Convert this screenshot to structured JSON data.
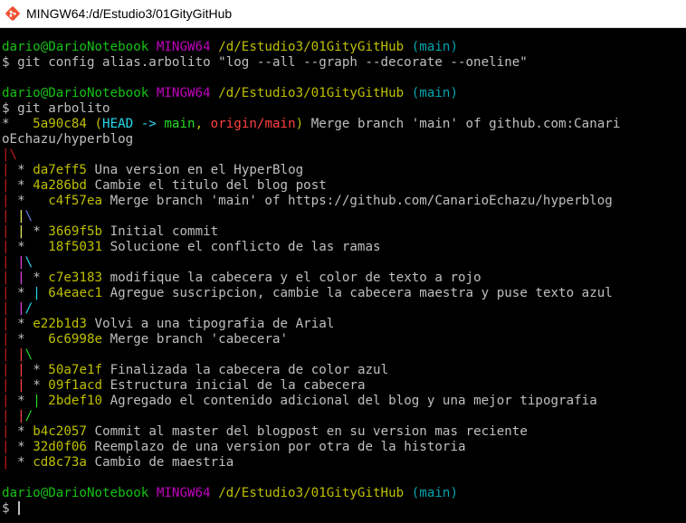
{
  "window": {
    "title": "MINGW64:/d/Estudio3/01GityGitHub",
    "icon": "git-bash-icon"
  },
  "colors": {
    "background": "#000000",
    "default": "#bfbfbf",
    "green": "#15c215",
    "magenta": "#c000c0",
    "yellow": "#bfbf00",
    "cyan": "#00a6b2",
    "red": "#c41b17",
    "brightRed": "#ff4040",
    "brightCyan": "#25d8ec",
    "brightGreen": "#25d825",
    "brightYellow": "#e8e85a",
    "brightMagenta": "#e040e0",
    "blue": "#5c7ee0"
  },
  "terminal": {
    "lines": [
      [
        {
          "t": "dario@DarioNotebook",
          "c": "green"
        },
        {
          "t": " ",
          "c": "default"
        },
        {
          "t": "MINGW64",
          "c": "magenta"
        },
        {
          "t": " ",
          "c": "default"
        },
        {
          "t": "/d/Estudio3/01GityGitHub",
          "c": "yellow"
        },
        {
          "t": " ",
          "c": "default"
        },
        {
          "t": "(main)",
          "c": "cyan"
        }
      ],
      [
        {
          "t": "$ git config alias.arbolito \"log --all --graph --decorate --oneline\"",
          "c": "default"
        }
      ],
      [],
      [
        {
          "t": "dario@DarioNotebook",
          "c": "green"
        },
        {
          "t": " ",
          "c": "default"
        },
        {
          "t": "MINGW64",
          "c": "magenta"
        },
        {
          "t": " ",
          "c": "default"
        },
        {
          "t": "/d/Estudio3/01GityGitHub",
          "c": "yellow"
        },
        {
          "t": " ",
          "c": "default"
        },
        {
          "t": "(main)",
          "c": "cyan"
        }
      ],
      [
        {
          "t": "$ git arbolito",
          "c": "default"
        }
      ],
      [
        {
          "t": "*   ",
          "c": "default"
        },
        {
          "t": "5a90c84 (",
          "c": "yellow"
        },
        {
          "t": "HEAD -> ",
          "c": "brightCyan"
        },
        {
          "t": "main",
          "c": "brightGreen"
        },
        {
          "t": ", ",
          "c": "yellow"
        },
        {
          "t": "origin/main",
          "c": "brightRed"
        },
        {
          "t": ")",
          "c": "yellow"
        },
        {
          "t": " Merge branch 'main' of github.com:Canari",
          "c": "default"
        }
      ],
      [
        {
          "t": "oEchazu/hyperblog",
          "c": "default"
        }
      ],
      [
        {
          "t": "|\\",
          "c": "red"
        }
      ],
      [
        {
          "t": "| ",
          "c": "red"
        },
        {
          "t": "* ",
          "c": "default"
        },
        {
          "t": "da7eff5",
          "c": "yellow"
        },
        {
          "t": " Una version en el HyperBlog",
          "c": "default"
        }
      ],
      [
        {
          "t": "| ",
          "c": "red"
        },
        {
          "t": "* ",
          "c": "default"
        },
        {
          "t": "4a286bd",
          "c": "yellow"
        },
        {
          "t": " Cambie el titulo del blog post",
          "c": "default"
        }
      ],
      [
        {
          "t": "| ",
          "c": "red"
        },
        {
          "t": "*   ",
          "c": "default"
        },
        {
          "t": "c4f57ea",
          "c": "yellow"
        },
        {
          "t": " Merge branch 'main' of https://github.com/CanarioEchazu/hyperblog",
          "c": "default"
        }
      ],
      [
        {
          "t": "| ",
          "c": "red"
        },
        {
          "t": "|",
          "c": "brightYellow"
        },
        {
          "t": "\\",
          "c": "blue"
        }
      ],
      [
        {
          "t": "| ",
          "c": "red"
        },
        {
          "t": "| ",
          "c": "brightYellow"
        },
        {
          "t": "* ",
          "c": "default"
        },
        {
          "t": "3669f5b",
          "c": "yellow"
        },
        {
          "t": " Initial commit",
          "c": "default"
        }
      ],
      [
        {
          "t": "| ",
          "c": "red"
        },
        {
          "t": "*   ",
          "c": "default"
        },
        {
          "t": "18f5031",
          "c": "yellow"
        },
        {
          "t": " Solucione el conflicto de las ramas",
          "c": "default"
        }
      ],
      [
        {
          "t": "| ",
          "c": "red"
        },
        {
          "t": "|",
          "c": "brightMagenta"
        },
        {
          "t": "\\",
          "c": "brightCyan"
        }
      ],
      [
        {
          "t": "| ",
          "c": "red"
        },
        {
          "t": "| ",
          "c": "brightMagenta"
        },
        {
          "t": "* ",
          "c": "default"
        },
        {
          "t": "c7e3183",
          "c": "yellow"
        },
        {
          "t": " modifique la cabecera y el color de texto a rojo",
          "c": "default"
        }
      ],
      [
        {
          "t": "| ",
          "c": "red"
        },
        {
          "t": "* ",
          "c": "default"
        },
        {
          "t": "| ",
          "c": "brightCyan"
        },
        {
          "t": "64eaec1",
          "c": "yellow"
        },
        {
          "t": " Agregue suscripcion, cambie la cabecera maestra y puse texto azul",
          "c": "default"
        }
      ],
      [
        {
          "t": "| ",
          "c": "red"
        },
        {
          "t": "|",
          "c": "brightMagenta"
        },
        {
          "t": "/",
          "c": "brightCyan"
        }
      ],
      [
        {
          "t": "| ",
          "c": "red"
        },
        {
          "t": "* ",
          "c": "default"
        },
        {
          "t": "e22b1d3",
          "c": "yellow"
        },
        {
          "t": " Volvi a una tipografia de Arial",
          "c": "default"
        }
      ],
      [
        {
          "t": "| ",
          "c": "red"
        },
        {
          "t": "*   ",
          "c": "default"
        },
        {
          "t": "6c6998e",
          "c": "yellow"
        },
        {
          "t": " Merge branch 'cabecera'",
          "c": "default"
        }
      ],
      [
        {
          "t": "| ",
          "c": "red"
        },
        {
          "t": "|",
          "c": "brightRed"
        },
        {
          "t": "\\",
          "c": "brightGreen"
        }
      ],
      [
        {
          "t": "| ",
          "c": "red"
        },
        {
          "t": "| ",
          "c": "brightRed"
        },
        {
          "t": "* ",
          "c": "default"
        },
        {
          "t": "50a7e1f",
          "c": "yellow"
        },
        {
          "t": " Finalizada la cabecera de color azul",
          "c": "default"
        }
      ],
      [
        {
          "t": "| ",
          "c": "red"
        },
        {
          "t": "| ",
          "c": "brightRed"
        },
        {
          "t": "* ",
          "c": "default"
        },
        {
          "t": "09f1acd",
          "c": "yellow"
        },
        {
          "t": " Estructura inicial de la cabecera",
          "c": "default"
        }
      ],
      [
        {
          "t": "| ",
          "c": "red"
        },
        {
          "t": "* ",
          "c": "default"
        },
        {
          "t": "| ",
          "c": "brightGreen"
        },
        {
          "t": "2bdef10",
          "c": "yellow"
        },
        {
          "t": " Agregado el contenido adicional del blog y una mejor tipografia",
          "c": "default"
        }
      ],
      [
        {
          "t": "| ",
          "c": "red"
        },
        {
          "t": "|",
          "c": "brightRed"
        },
        {
          "t": "/",
          "c": "brightGreen"
        }
      ],
      [
        {
          "t": "| ",
          "c": "red"
        },
        {
          "t": "* ",
          "c": "default"
        },
        {
          "t": "b4c2057",
          "c": "yellow"
        },
        {
          "t": " Commit al master del blogpost en su version mas reciente",
          "c": "default"
        }
      ],
      [
        {
          "t": "| ",
          "c": "red"
        },
        {
          "t": "* ",
          "c": "default"
        },
        {
          "t": "32d0f06",
          "c": "yellow"
        },
        {
          "t": " Reemplazo de una version por otra de la historia",
          "c": "default"
        }
      ],
      [
        {
          "t": "| ",
          "c": "red"
        },
        {
          "t": "* ",
          "c": "default"
        },
        {
          "t": "cd8c73a",
          "c": "yellow"
        },
        {
          "t": " Cambio de maestria",
          "c": "default"
        }
      ],
      [],
      [
        {
          "t": "dario@DarioNotebook",
          "c": "green"
        },
        {
          "t": " ",
          "c": "default"
        },
        {
          "t": "MINGW64",
          "c": "magenta"
        },
        {
          "t": " ",
          "c": "default"
        },
        {
          "t": "/d/Estudio3/01GityGitHub",
          "c": "yellow"
        },
        {
          "t": " ",
          "c": "default"
        },
        {
          "t": "(main)",
          "c": "cyan"
        }
      ],
      [
        {
          "t": "$ ",
          "c": "default"
        }
      ]
    ]
  }
}
